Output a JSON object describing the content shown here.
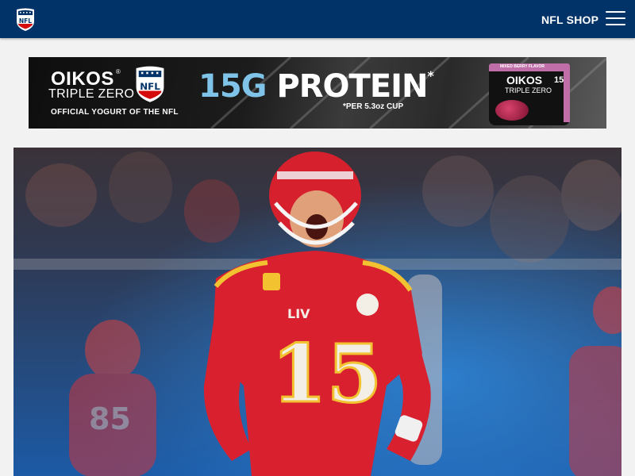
{
  "header": {
    "logo_icon": "nfl-shield-icon",
    "shop_label": "NFL SHOP",
    "menu_icon": "hamburger-menu-icon",
    "background": "#013369"
  },
  "ad": {
    "brand": "OIKOS",
    "brand_mark": "®",
    "subbrand": "TRIPLE ZERO",
    "official_text": "OFFICIAL YOGURT OF THE NFL",
    "headline_number": "15G",
    "headline_word": "PROTEIN",
    "headline_mark": "*",
    "footnote": "*PER 5.3oz CUP",
    "cup_flavor": "MIXED BERRY FLAVOR",
    "cup_brand": "OIKOS",
    "cup_subbrand": "TRIPLE ZERO",
    "cup_count": "15",
    "accent_color": "#7fc4e8",
    "cup_color": "#c06ea8"
  },
  "hero": {
    "image_description": "Kansas City Chiefs quarterback celebrating",
    "jersey_number": "15"
  },
  "colors": {
    "nfl_navy": "#013369",
    "nfl_red": "#d50a0a",
    "chiefs_red": "#e31837",
    "chiefs_gold": "#ffb612"
  }
}
